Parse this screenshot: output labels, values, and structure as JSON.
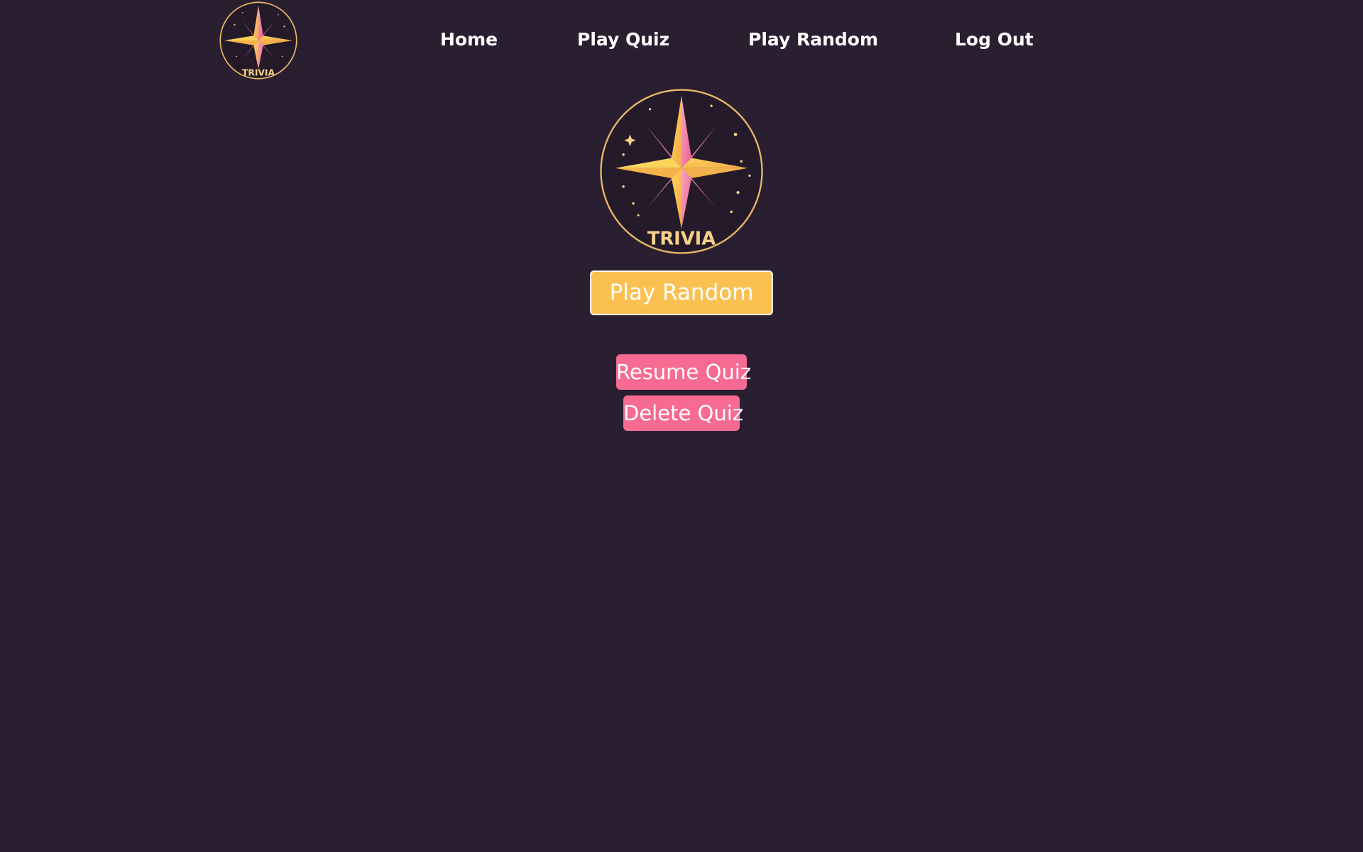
{
  "nav": {
    "logo": {
      "text": "TRIVIA",
      "icon": "trivia-star-logo"
    },
    "links": {
      "home": "Home",
      "play_quiz": "Play Quiz",
      "play_random": "Play Random",
      "log_out": "Log Out"
    }
  },
  "main": {
    "logo": {
      "text": "TRIVIA",
      "icon": "trivia-star-logo"
    },
    "play_random_label": "Play Random",
    "resume_quiz_label": "Resume Quiz",
    "delete_quiz_label": "Delete Quiz"
  },
  "colors": {
    "background": "#2a1f30",
    "primary_button": "#fbc150",
    "secondary_button": "#f76a92",
    "star_gold": "#f9c74f",
    "star_pink": "#f06f97",
    "ring_gold": "#e8b86a"
  }
}
